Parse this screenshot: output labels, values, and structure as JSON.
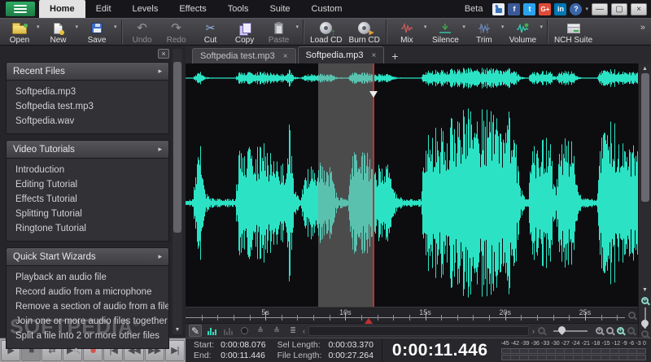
{
  "titlebar": {
    "beta": "Beta",
    "menu_items": [
      {
        "label": "Home",
        "active": true
      },
      {
        "label": "Edit",
        "active": false
      },
      {
        "label": "Levels",
        "active": false
      },
      {
        "label": "Effects",
        "active": false
      },
      {
        "label": "Tools",
        "active": false
      },
      {
        "label": "Suite",
        "active": false
      },
      {
        "label": "Custom",
        "active": false
      }
    ],
    "social_icons": [
      "thumbs-up",
      "facebook",
      "twitter",
      "google-plus",
      "linkedin",
      "help"
    ],
    "social_glyphs": {
      "facebook": "f",
      "twitter": "t",
      "google_plus": "G+",
      "linkedin": "in",
      "help": "?"
    },
    "window_controls": {
      "minimize": "—",
      "restore": "▢",
      "close": "×"
    }
  },
  "toolbar": {
    "buttons": {
      "open": "Open",
      "new": "New",
      "save": "Save",
      "undo": "Undo",
      "redo": "Redo",
      "cut": "Cut",
      "copy": "Copy",
      "paste": "Paste",
      "load_cd": "Load CD",
      "burn_cd": "Burn CD",
      "mix": "Mix",
      "silence": "Silence",
      "trim": "Trim",
      "volume": "Volume",
      "nch_suite": "NCH Suite"
    },
    "overflow": "»",
    "dropdown_glyph": "▾"
  },
  "sidebar": {
    "close_glyph": "×",
    "scroll_down_glyph": "▼",
    "sections": [
      {
        "title": "Recent Files",
        "items": [
          "Softpedia.mp3",
          "Softpedia test.mp3",
          "Softpedia.wav"
        ]
      },
      {
        "title": "Video Tutorials",
        "items": [
          "Introduction",
          "Editing Tutorial",
          "Effects Tutorial",
          "Splitting Tutorial",
          "Ringtone Tutorial"
        ]
      },
      {
        "title": "Quick Start Wizards",
        "items": [
          "Playback an audio file",
          "Record audio from a microphone",
          "Remove a section of audio from a file",
          "Join one or more audio files together",
          "Split a file into 2 or more other files"
        ]
      }
    ],
    "watermark": "SOFTPEDIA",
    "watermark_mark": "®"
  },
  "document_tabs": {
    "tabs": [
      {
        "label": "Softpedia test.mp3",
        "active": false
      },
      {
        "label": "Softpedia.mp3",
        "active": true
      }
    ],
    "close_glyph": "×",
    "add_label": "+"
  },
  "waveform": {
    "seed": 9,
    "color": "#2be3c4",
    "selection_color": "rgba(150,150,150,0.45)",
    "playhead_color": "#c23030",
    "selection_start_pct": 29.4,
    "selection_end_pct": 41.6,
    "playhead_pct": 41.6
  },
  "ruler": {
    "total_seconds": 27.5,
    "labels": [
      {
        "text": "5s",
        "sec": 5
      },
      {
        "text": "10s",
        "sec": 10
      },
      {
        "text": "15s",
        "sec": 15
      },
      {
        "text": "20s",
        "sec": 20
      },
      {
        "text": "25s",
        "sec": 25
      }
    ]
  },
  "transport": {
    "play": "▶",
    "stop": "■",
    "loop": "⇄",
    "scrub": "▶",
    "record": "●",
    "go_start": "|◀",
    "rewind": "◀◀",
    "fast_forward": "▶▶",
    "go_end": "▶|"
  },
  "status": {
    "start_label": "Start:",
    "start": "0:00:08.076",
    "end_label": "End:",
    "end": "0:00:11.446",
    "sel_length_label": "Sel Length:",
    "sel_length": "0:00:03.370",
    "file_length_label": "File Length:",
    "file_length": "0:00:27.264",
    "time_display": "0:00:11.446"
  },
  "meter": {
    "labels": [
      "-45",
      "-42",
      "-39",
      "-36",
      "-33",
      "-30",
      "-27",
      "-24",
      "-21",
      "-18",
      "-15",
      "-12",
      "-9",
      "-6",
      "-3",
      "0"
    ],
    "segments": 16
  }
}
